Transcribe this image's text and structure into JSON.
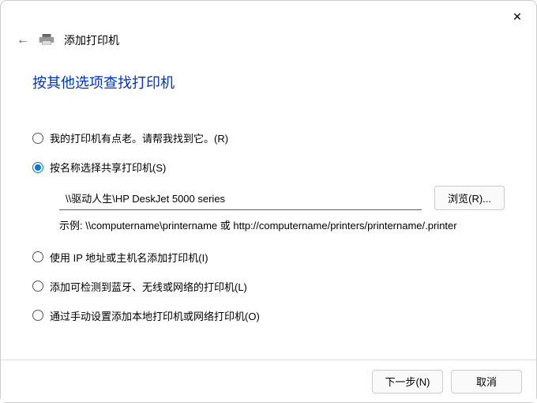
{
  "header": {
    "title": "添加打印机"
  },
  "page_title": "按其他选项查找打印机",
  "options": {
    "old_printer": "我的打印机有点老。请帮我找到它。(R)",
    "by_name": "按名称选择共享打印机(S)",
    "by_ip": "使用 IP 地址或主机名添加打印机(I)",
    "bluetooth": "添加可检测到蓝牙、无线或网络的打印机(L)",
    "manual": "通过手动设置添加本地打印机或网络打印机(O)"
  },
  "shared": {
    "input_value": "\\\\驱动人生\\HP DeskJet 5000 series",
    "browse_label": "浏览(R)...",
    "example": "示例: \\\\computername\\printername 或 http://computername/printers/printername/.printer"
  },
  "footer": {
    "next": "下一步(N)",
    "cancel": "取消"
  },
  "selected_option": "by_name"
}
